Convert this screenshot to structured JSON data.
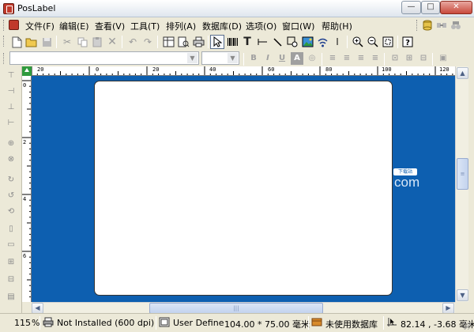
{
  "window": {
    "title": "PosLabel",
    "min_glyph": "—",
    "max_glyph": "□",
    "close_glyph": "✕"
  },
  "menu": {
    "items": [
      "文件(F)",
      "编辑(E)",
      "查看(V)",
      "工具(T)",
      "排列(A)",
      "数据库(D)",
      "选项(O)",
      "窗口(W)",
      "帮助(H)"
    ]
  },
  "ruler": {
    "h_labels": [
      "20",
      "0",
      "20",
      "40",
      "60",
      "80",
      "100",
      "120"
    ],
    "v_labels": [
      "0",
      "2",
      "4",
      "6"
    ]
  },
  "watermark": {
    "badge": "下载站",
    "domain_text": "com"
  },
  "scroll": {
    "thumb_grip": "|||"
  },
  "statusbar": {
    "zoom": "115",
    "zoom_unit": "%",
    "printer": "Not Installed (600 dpi)",
    "page_type": "User Define",
    "page_size": "104.00 * 75.00 毫米",
    "database": "未使用数据库",
    "cursor_pos": "82.14 , -3.68 毫米"
  },
  "colors": {
    "canvas_bg": "#0d5fb0",
    "chrome_bg": "#ece9d8",
    "corner_green": "#2f9a3d"
  }
}
